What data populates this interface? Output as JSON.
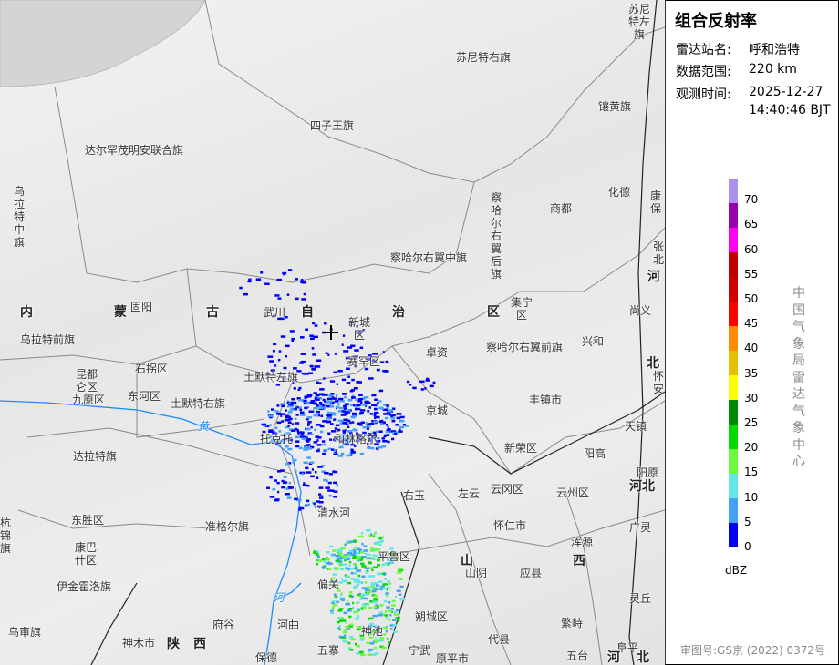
{
  "panel": {
    "title": "组合反射率",
    "station_label": "雷达站名:",
    "station": "呼和浩特",
    "range_label": "数据范围:",
    "range": "220 km",
    "time_label": "观测时间:",
    "date": "2025-12-27",
    "time": "14:40:46 BJT",
    "legend": {
      "unit": "dBZ",
      "ticks": [
        "0",
        "5",
        "10",
        "15",
        "20",
        "25",
        "30",
        "35",
        "40",
        "45",
        "50",
        "55",
        "60",
        "65",
        "70"
      ],
      "colors": [
        "#0000f6",
        "#44a0f8",
        "#62e6ea",
        "#6cfa3c",
        "#00dc00",
        "#008c00",
        "#ffff00",
        "#e6c000",
        "#ff8c00",
        "#ff0000",
        "#d00000",
        "#c00000",
        "#ff00f0",
        "#9800b0",
        "#ae90ee"
      ]
    },
    "organization": "中国气象局雷达气象中心",
    "approval": "审图号:GS京 (2022) 0372号"
  },
  "map": {
    "radar_site_icon": "crosshair-icon",
    "river_color": "#1a8cff",
    "labels": [
      "苏尼特右旗",
      "四子王旗",
      "达尔罕茂明安联合旗",
      "乌拉特中旗",
      "察哈尔右翼中旗",
      "察哈尔右翼后旗",
      "商都",
      "化德",
      "镶黄旗",
      "苏尼特左旗",
      "康保",
      "张北",
      "河",
      "尚义",
      "内",
      "蒙",
      "古",
      "自",
      "治",
      "区",
      "固阳",
      "武川",
      "新城区",
      "集宁区",
      "兴和",
      "卓资",
      "察哈尔右翼前旗",
      "乌拉特前旗",
      "昆都仑区",
      "石拐区",
      "赛罕区",
      "土默特左旗",
      "九原区",
      "东河区",
      "土默特右旗",
      "丰镇市",
      "京城",
      "北",
      "怀安",
      "天镇",
      "黄",
      "托克托",
      "和林格尔",
      "新荣区",
      "阳高",
      "达拉特旗",
      "阳原",
      "河北",
      "右玉",
      "左云",
      "云冈区",
      "云州区",
      "清水河",
      "东胜区",
      "准格尔旗",
      "怀仁市",
      "广灵",
      "浑源",
      "杭锦旗",
      "康巴什区",
      "平鲁区",
      "山",
      "西",
      "山阴",
      "应县",
      "偏关",
      "伊金霍洛旗",
      "灵丘",
      "河",
      "朔城区",
      "乌审旗",
      "府谷",
      "河曲",
      "神池",
      "繁峙",
      "神木市",
      "陕",
      "西",
      "代县",
      "五寨",
      "宁武",
      "原平市",
      "保德",
      "五台",
      "阜平",
      "河",
      "北"
    ]
  }
}
